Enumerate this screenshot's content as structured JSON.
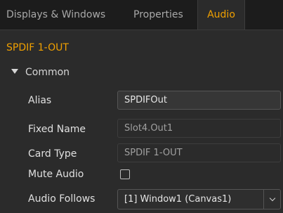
{
  "tabs": [
    {
      "label": "Displays & Windows",
      "active": false
    },
    {
      "label": "Properties",
      "active": false
    },
    {
      "label": "Audio",
      "active": true
    }
  ],
  "colors": {
    "accent": "#f0a000",
    "panel_bg": "#2b2b2b",
    "window_bg": "#1c1c1c"
  },
  "section": {
    "title": "SPDIF 1-OUT"
  },
  "group": {
    "label": "Common",
    "expanded": true,
    "icon": "triangle-down-icon"
  },
  "fields": {
    "alias": {
      "label": "Alias",
      "value": "SPDIFOut"
    },
    "fixed_name": {
      "label": "Fixed Name",
      "value": "Slot4.Out1"
    },
    "card_type": {
      "label": "Card Type",
      "value": "SPDIF 1-OUT"
    },
    "mute_audio": {
      "label": "Mute Audio",
      "checked": false
    },
    "audio_follows": {
      "label": "Audio Follows",
      "value": "[1] Window1 (Canvas1)",
      "icon": "chevron-down-icon"
    }
  }
}
